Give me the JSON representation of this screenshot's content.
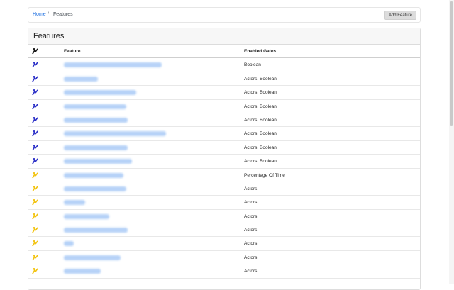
{
  "breadcrumb": {
    "home": "Home",
    "separator": "/",
    "current": "Features"
  },
  "toolbar": {
    "add_label": "Add Feature"
  },
  "card": {
    "title": "Features"
  },
  "table": {
    "headers": {
      "feature": "Feature",
      "gates": "Enabled Gates"
    },
    "colors": {
      "enabled": "#2b2fc7",
      "conditional": "#f2c30f"
    },
    "rows": [
      {
        "status": "enabled",
        "gates": "Boolean"
      },
      {
        "status": "enabled",
        "gates": "Actors, Boolean"
      },
      {
        "status": "enabled",
        "gates": "Actors, Boolean"
      },
      {
        "status": "enabled",
        "gates": "Actors, Boolean"
      },
      {
        "status": "enabled",
        "gates": "Actors, Boolean"
      },
      {
        "status": "enabled",
        "gates": "Actors, Boolean"
      },
      {
        "status": "enabled",
        "gates": "Actors, Boolean"
      },
      {
        "status": "enabled",
        "gates": "Actors, Boolean"
      },
      {
        "status": "conditional",
        "gates": "Percentage Of Time"
      },
      {
        "status": "conditional",
        "gates": "Actors"
      },
      {
        "status": "conditional",
        "gates": "Actors"
      },
      {
        "status": "conditional",
        "gates": "Actors"
      },
      {
        "status": "conditional",
        "gates": "Actors"
      },
      {
        "status": "conditional",
        "gates": "Actors"
      },
      {
        "status": "conditional",
        "gates": "Actors"
      },
      {
        "status": "conditional",
        "gates": "Actors"
      }
    ]
  }
}
